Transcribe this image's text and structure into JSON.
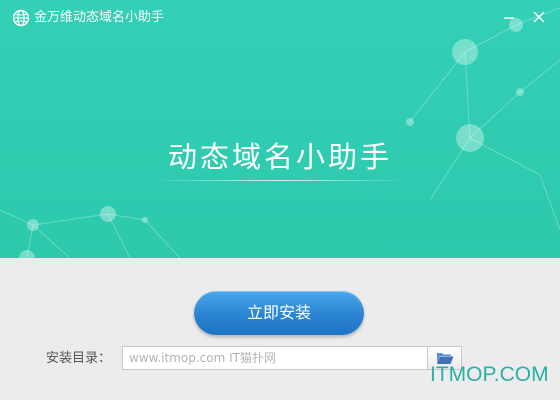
{
  "window": {
    "title": "金万维动态域名小助手",
    "logo_icon": "globe-icon",
    "minimize_icon": "minimize-icon",
    "close_icon": "close-icon"
  },
  "hero": {
    "title": "动态域名小助手"
  },
  "install": {
    "button_label": "立即安装",
    "directory_label": "安装目录：",
    "directory_placeholder": "www.itmop.com IT猫扑网",
    "browse_icon": "folder-open-icon"
  },
  "watermark": "ITMOP.COM",
  "colors": {
    "hero_background": "#2dc9ad",
    "accent_blue": "#2a84d3",
    "watermark": "#2bb0a4"
  }
}
